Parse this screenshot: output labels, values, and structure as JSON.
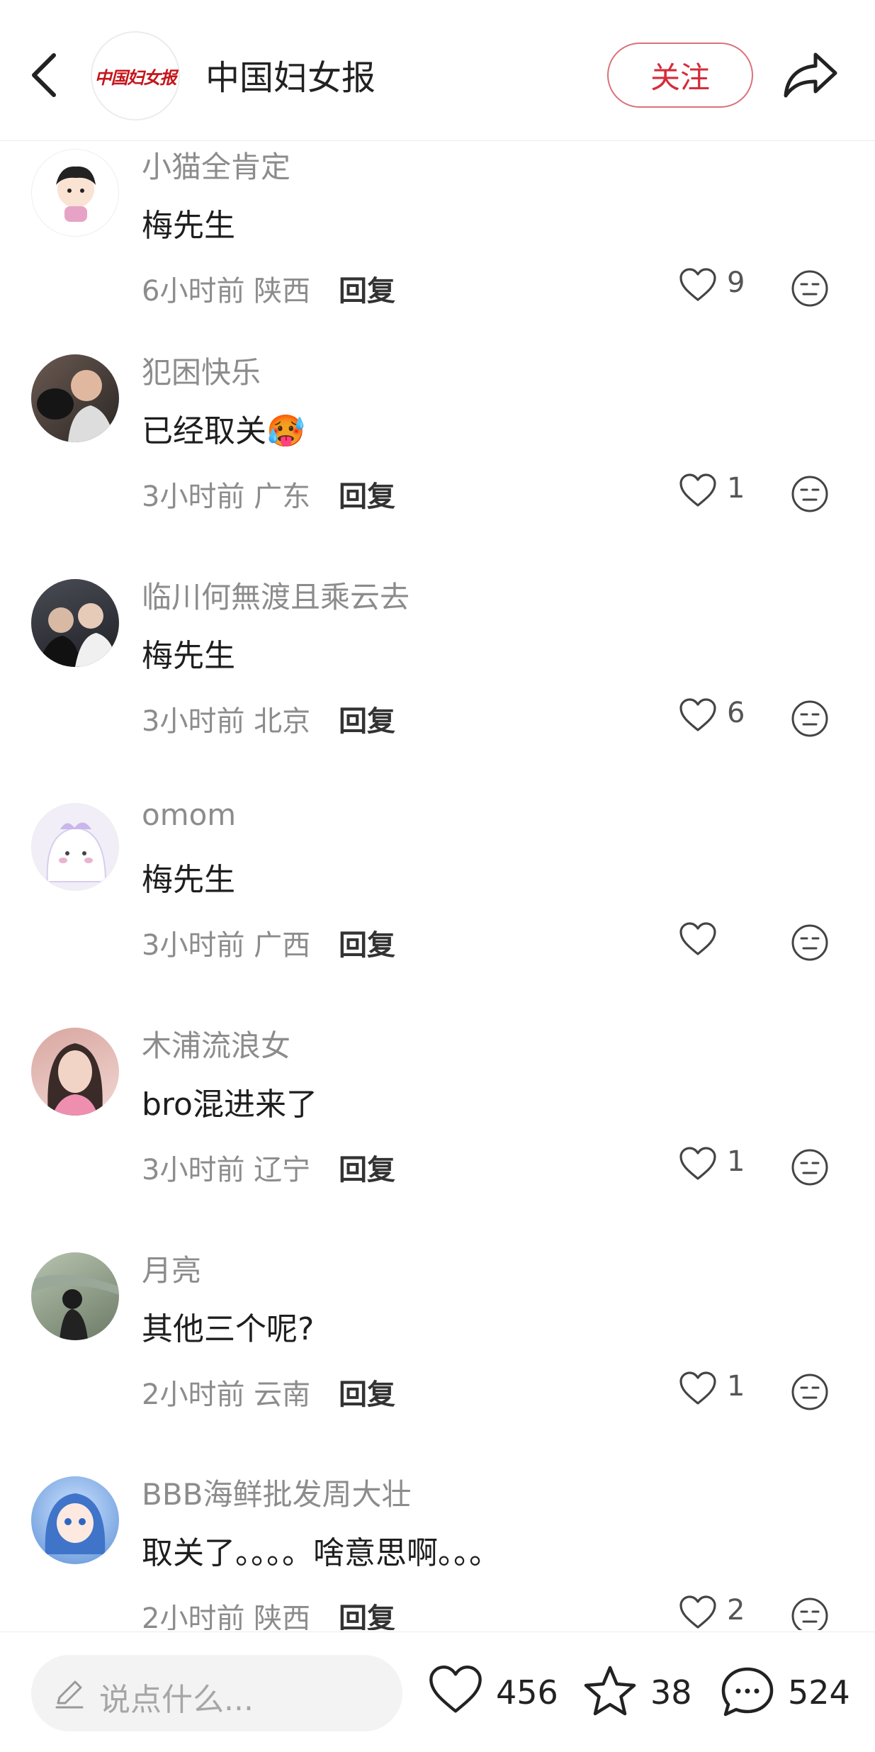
{
  "header": {
    "logo_text": "中国妇女报",
    "title": "中国妇女报",
    "follow_label": "关注"
  },
  "comments": [
    {
      "user": "小猫全肯定",
      "text": "梅先生",
      "time": "6小时前",
      "location": "陕西",
      "reply": "回复",
      "likes": "9"
    },
    {
      "user": "犯困快乐",
      "text": "已经取关",
      "emoji": "🥵",
      "time": "3小时前",
      "location": "广东",
      "reply": "回复",
      "likes": "1"
    },
    {
      "user": "临川何無渡且乘云去",
      "text": "梅先生",
      "time": "3小时前",
      "location": "北京",
      "reply": "回复",
      "likes": "6"
    },
    {
      "user": "omom",
      "text": "梅先生",
      "time": "3小时前",
      "location": "广西",
      "reply": "回复",
      "likes": ""
    },
    {
      "user": "木浦流浪女",
      "text": "bro混进来了",
      "time": "3小时前",
      "location": "辽宁",
      "reply": "回复",
      "likes": "1"
    },
    {
      "user": "月亮",
      "text": "其他三个呢?",
      "time": "2小时前",
      "location": "云南",
      "reply": "回复",
      "likes": "1"
    },
    {
      "user": "BBB海鲜批发周大壮",
      "text": "取关了。。。。啥意思啊。。。",
      "time": "2小时前",
      "location": "陕西",
      "reply": "回复",
      "likes": "2"
    }
  ],
  "bottom": {
    "input_placeholder": "说点什么...",
    "likes": "456",
    "favorites": "38",
    "comments": "524"
  },
  "colors": {
    "accent": "#d62b3a",
    "muted_text": "#8c8c8c"
  }
}
